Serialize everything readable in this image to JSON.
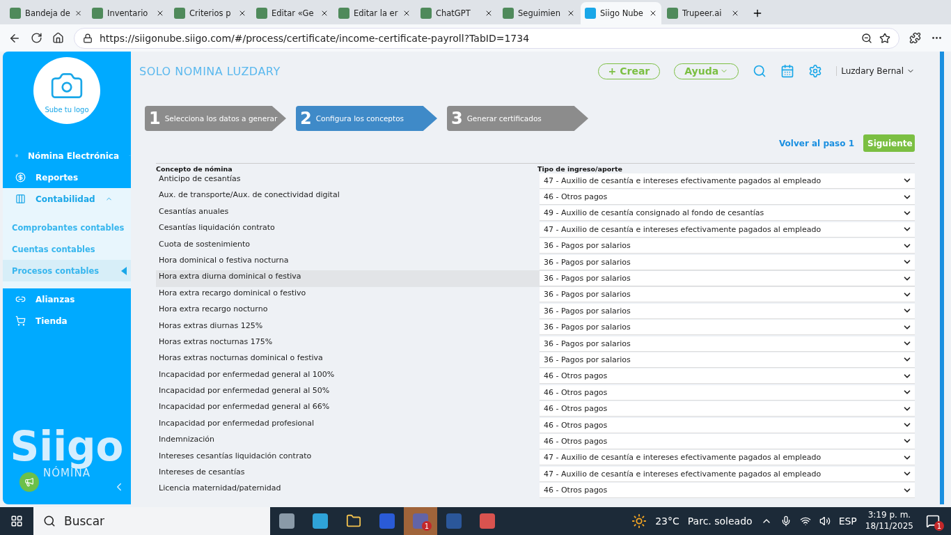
{
  "browser": {
    "tabs": [
      {
        "label": "Bandeja de",
        "selected": false
      },
      {
        "label": "Inventario",
        "selected": false
      },
      {
        "label": "Criterios p",
        "selected": false
      },
      {
        "label": "Editar «Ge",
        "selected": false
      },
      {
        "label": "Editar la er",
        "selected": false
      },
      {
        "label": "ChatGPT",
        "selected": false
      },
      {
        "label": "Seguimien",
        "selected": false
      },
      {
        "label": "Siigo Nube",
        "selected": true
      },
      {
        "label": "Trupeer.ai",
        "selected": false
      }
    ],
    "url": "https://siigonube.siigo.com/#/process/certificate/income-certificate-payroll?TabID=1734"
  },
  "sidebar": {
    "logo_caption": "Sube tu logo",
    "items": [
      {
        "label": "Nómina Electrónica",
        "expanded": false
      },
      {
        "label": "Reportes"
      },
      {
        "label": "Contabilidad",
        "expanded": true,
        "children": [
          {
            "label": "Comprobantes contables",
            "selected": false
          },
          {
            "label": "Cuentas contables",
            "selected": false
          },
          {
            "label": "Procesos contables",
            "selected": true
          }
        ]
      },
      {
        "label": "Alianzas"
      },
      {
        "label": "Tienda"
      }
    ],
    "brand": "Siigo",
    "brand_sub": "NÓMINA"
  },
  "header": {
    "company": "SOLO NOMINA LUZDARY",
    "create": "+ Crear",
    "help": "Ayuda",
    "user": "Luzdary Bernal"
  },
  "steps": [
    {
      "number": "1",
      "label": "Selecciona los datos a generar",
      "selected": false
    },
    {
      "number": "2",
      "label": "Configura los conceptos",
      "selected": true
    },
    {
      "number": "3",
      "label": "Generar certificados",
      "selected": false
    }
  ],
  "actions": {
    "back": "Volver al paso 1",
    "next": "Siguiente"
  },
  "table": {
    "columns": [
      "Concepto de nómina",
      "Tipo de ingreso/aporte"
    ],
    "rows": [
      {
        "concept": "Anticipo de cesantías",
        "type": "47 - Auxilio de cesantía e intereses efectivamente pagados al empleado",
        "hovered": false
      },
      {
        "concept": "Aux. de transporte/Aux. de conectividad digital",
        "type": "46 - Otros pagos",
        "hovered": false
      },
      {
        "concept": "Cesantías anuales",
        "type": "49 - Auxilio de cesantía consignado al fondo de cesantías",
        "hovered": false
      },
      {
        "concept": "Cesantías liquidación contrato",
        "type": "47 - Auxilio de cesantía e intereses efectivamente pagados al empleado",
        "hovered": false
      },
      {
        "concept": "Cuota de sostenimiento",
        "type": "36 - Pagos por salarios",
        "hovered": false
      },
      {
        "concept": "Hora dominical o festiva nocturna",
        "type": "36 - Pagos por salarios",
        "hovered": false
      },
      {
        "concept": "Hora extra diurna dominical o festiva",
        "type": "36 - Pagos por salarios",
        "hovered": true
      },
      {
        "concept": "Hora extra recargo dominical o festivo",
        "type": "36 - Pagos por salarios",
        "hovered": false
      },
      {
        "concept": "Hora extra recargo nocturno",
        "type": "36 - Pagos por salarios",
        "hovered": false
      },
      {
        "concept": "Horas extras diurnas 125%",
        "type": "36 - Pagos por salarios",
        "hovered": false
      },
      {
        "concept": "Horas extras nocturnas 175%",
        "type": "36 - Pagos por salarios",
        "hovered": false
      },
      {
        "concept": "Horas extras nocturnas dominical o festiva",
        "type": "36 - Pagos por salarios",
        "hovered": false
      },
      {
        "concept": "Incapacidad por enfermedad general al 100%",
        "type": "46 - Otros pagos",
        "hovered": false
      },
      {
        "concept": "Incapacidad por enfermedad general al 50%",
        "type": "46 - Otros pagos",
        "hovered": false
      },
      {
        "concept": "Incapacidad por enfermedad general al 66%",
        "type": "46 - Otros pagos",
        "hovered": false
      },
      {
        "concept": "Incapacidad por enfermedad profesional",
        "type": "46 - Otros pagos",
        "hovered": false
      },
      {
        "concept": "Indemnización",
        "type": "46 - Otros pagos",
        "hovered": false
      },
      {
        "concept": "Intereses cesantías liquidación contrato",
        "type": "47 - Auxilio de cesantía e intereses efectivamente pagados al empleado",
        "hovered": false
      },
      {
        "concept": "Intereses de cesantías",
        "type": "47 - Auxilio de cesantía e intereses efectivamente pagados al empleado",
        "hovered": false
      },
      {
        "concept": "Licencia maternidad/paternidad",
        "type": "46 - Otros pagos",
        "hovered": false
      }
    ]
  },
  "taskbar": {
    "search": "Buscar",
    "teams_badge": "1",
    "temperature": "23°C",
    "weather": "Parc. soleado",
    "language": "ESP",
    "time": "3:19 p. m.",
    "date": "18/11/2025",
    "notifications": "1"
  }
}
